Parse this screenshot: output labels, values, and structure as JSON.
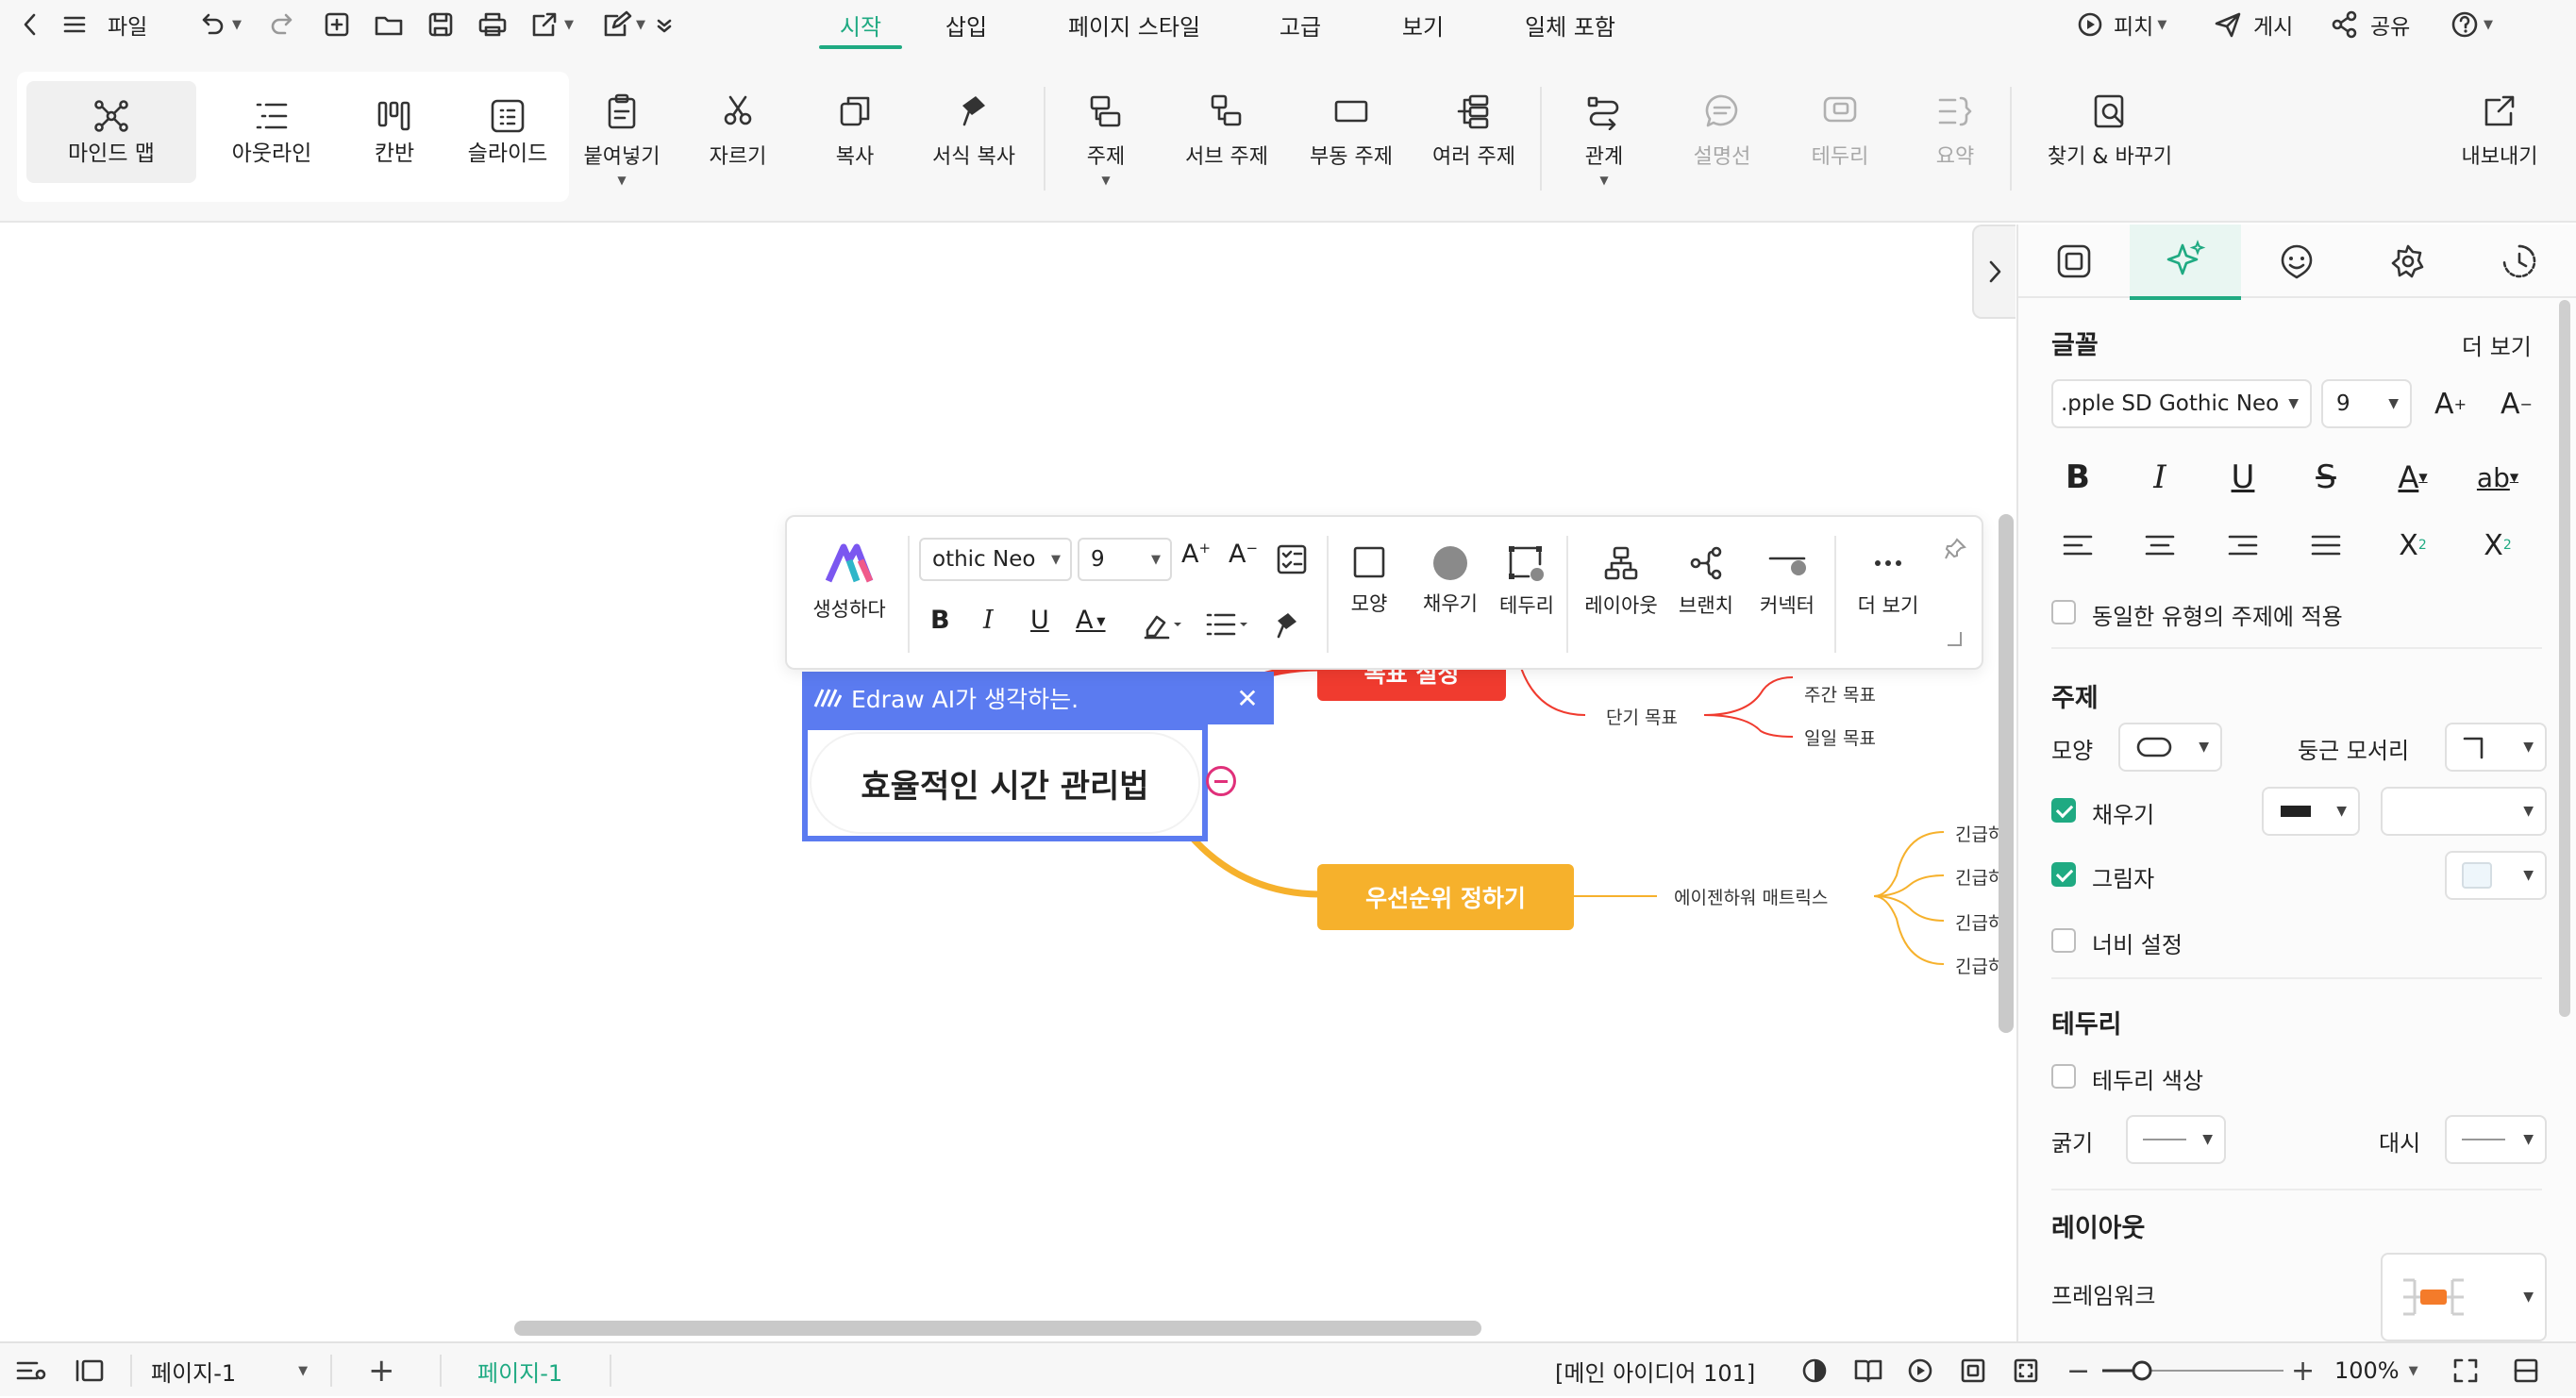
{
  "menubar": {
    "file_label": "파일",
    "tabs": [
      "시작",
      "삽입",
      "페이지 스타일",
      "고급",
      "보기",
      "일체 포함"
    ],
    "active_tab": "시작",
    "pitch_label": "피치",
    "publish_label": "게시",
    "share_label": "공유"
  },
  "ribbon": {
    "views": [
      "마인드 맵",
      "아웃라인",
      "칸반",
      "슬라이드"
    ],
    "active_view": "마인드 맵",
    "paste": "붙여넣기",
    "cut": "자르기",
    "copy": "복사",
    "format_painter": "서식 복사",
    "topic": "주제",
    "subtopic": "서브 주제",
    "floating_topic": "부동 주제",
    "multiple_topics": "여러 주제",
    "relationship": "관계",
    "callout": "설명선",
    "boundary": "테두리",
    "summary": "요약",
    "find_replace": "찾기 & 바꾸기",
    "export": "내보내기"
  },
  "floating_toolbar": {
    "generate": "생성하다",
    "font_value": "othic Neo",
    "size_value": "9",
    "shape": "모양",
    "fill": "채우기",
    "border": "테두리",
    "layout": "레이아웃",
    "branch": "브랜치",
    "connector": "커넥터",
    "more": "더 보기"
  },
  "ai_status": "Edraw AI가 생각하는.",
  "mindmap": {
    "central": "효율적인 시간 관리법",
    "goal_topic": "목표 설정",
    "goal_child": "단기 목표",
    "goal_grandchildren": [
      "주간 목표",
      "일일 목표"
    ],
    "priority_topic": "우선순위 정하기",
    "priority_child": "에이젠하워 매트릭스",
    "priority_grandchildren": [
      "긴급하",
      "긴급하",
      "긴급하",
      "긴급하"
    ],
    "colors": {
      "goal": "#f03b2f",
      "priority": "#f6b12c",
      "accent": "#5b7bf0"
    }
  },
  "panel": {
    "font_section": "글꼴",
    "more": "더 보기",
    "font_value": ".pple SD Gothic Neo",
    "font_size": "9",
    "apply_same": "동일한 유형의 주제에 적용",
    "topic_section": "주제",
    "shape_label": "모양",
    "corner_label": "둥근 모서리",
    "fill_label": "채우기",
    "shadow_label": "그림자",
    "width_label": "너비 설정",
    "border_section": "테두리",
    "border_color": "테두리 색상",
    "thickness_label": "굵기",
    "dash_label": "대시",
    "layout_section": "레이아웃",
    "framework_label": "프레임워크",
    "checks": {
      "apply_same": false,
      "fill": true,
      "shadow": true,
      "width": false,
      "border_color": false
    }
  },
  "statusbar": {
    "page_select": "페이지-1",
    "page_tab": "페이지-1",
    "info": "[메인 아이디어 101]",
    "zoom": "100%"
  }
}
